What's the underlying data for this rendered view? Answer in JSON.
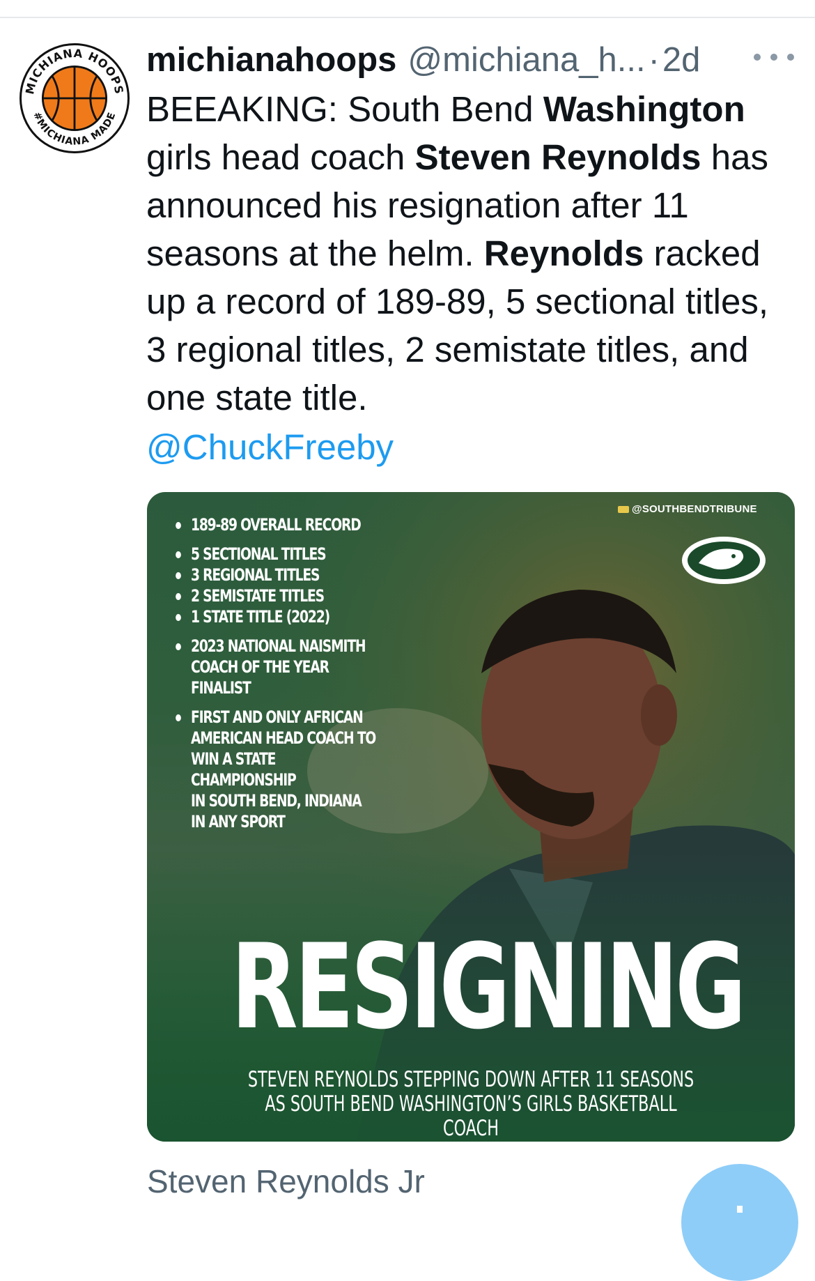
{
  "tweet": {
    "display_name": "michianahoops",
    "handle": "@michiana_h...",
    "separator": "·",
    "time": "2d",
    "text": {
      "p1": "BEEAKING: South Bend ",
      "b1": "Washington",
      "p2": " girls head coach ",
      "b2": "Steven Reynolds",
      "p3": " has announced his resignation after 11 seasons at the helm. ",
      "b3": "Reynolds",
      "p4": " racked up a record of 189-89, 5 sectional titles, 3 regional titles, 2 semistate titles, and one state title."
    },
    "mention": "@ChuckFreeby"
  },
  "avatar": {
    "ring_top": "MICHIANA HOOPS",
    "ring_bottom": "#MICHIANA MADE"
  },
  "media": {
    "credit": "@SOUTHBENDTRIBUNE",
    "stats": [
      "189-89 OVERALL RECORD",
      "5 SECTIONAL TITLES",
      "3 REGIONAL TITLES",
      "2 SEMISTATE TITLES",
      "1 STATE TITLE (2022)",
      "2023 NATIONAL NAISMITH\nCOACH OF THE YEAR FINALIST",
      "FIRST AND ONLY AFRICAN\nAMERICAN HEAD COACH TO\nWIN A STATE CHAMPIONSHIP\nIN SOUTH BEND, INDIANA\nIN ANY SPORT"
    ],
    "headline": "RESIGNING",
    "subhead_line1": "STEVEN REYNOLDS STEPPING DOWN AFTER 11 SEASONS",
    "subhead_line2": "AS SOUTH BEND WASHINGTON’S GIRLS BASKETBALL COACH"
  },
  "media_caption": "Steven Reynolds Jr",
  "colors": {
    "link": "#1d9bf0",
    "secondary_text": "#536471",
    "media_green": "#2f5e3b",
    "fab": "#8ecdf8"
  }
}
